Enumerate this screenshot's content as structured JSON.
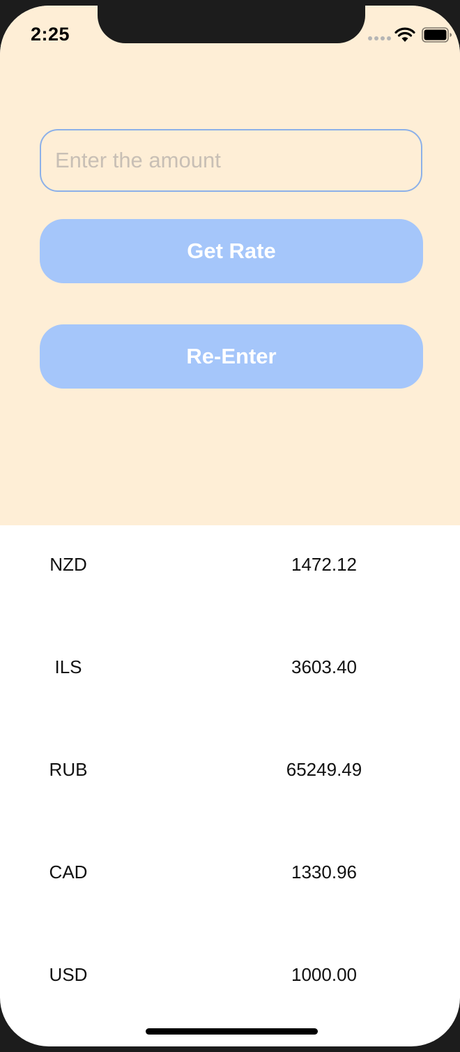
{
  "status_bar": {
    "time": "2:25",
    "icons": [
      "cellular-signal-icon",
      "wifi-icon",
      "battery-icon"
    ]
  },
  "form": {
    "amount_placeholder": "Enter the amount",
    "amount_value": "",
    "get_rate_label": "Get Rate",
    "re_enter_label": "Re-Enter"
  },
  "rates": [
    {
      "code": "NZD",
      "value": "1472.12"
    },
    {
      "code": "ILS",
      "value": "3603.40"
    },
    {
      "code": "RUB",
      "value": "65249.49"
    },
    {
      "code": "CAD",
      "value": "1330.96"
    },
    {
      "code": "USD",
      "value": "1000.00"
    }
  ],
  "colors": {
    "top_background": "#feeed6",
    "button": "#a5c6fa",
    "input_border": "#8cb0e8",
    "list_background": "#ffffff"
  }
}
